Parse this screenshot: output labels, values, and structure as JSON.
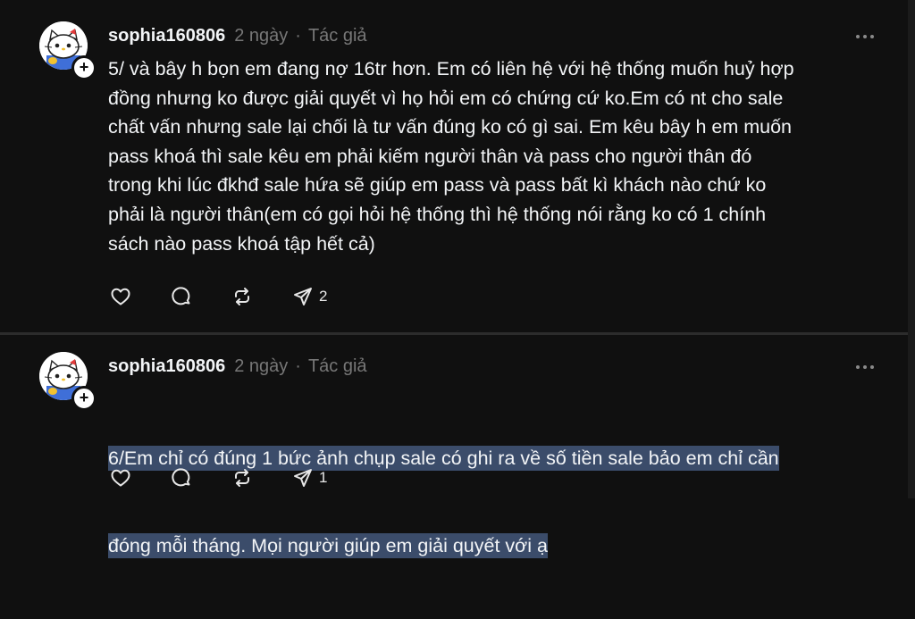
{
  "posts": [
    {
      "username": "sophia160806",
      "time": "2 ngày",
      "separator": "·",
      "role": "Tác giả",
      "follow_symbol": "+",
      "text": "5/ và bây h bọn em đang nợ 16tr hơn. Em có liên hệ với hệ thống muốn huỷ hợp\nđồng nhưng ko được giải quyết vì họ hỏi em có chứng cứ ko.Em có nt cho sale\nchất vấn nhưng sale lại chối là tư vấn đúng ko có gì sai. Em kêu bây h em muốn\npass khoá thì sale kêu em phải kiếm người thân và pass cho người thân đó\ntrong khi lúc đkhđ sale hứa sẽ giúp em pass và pass bất kì khách nào chứ ko\nphải là người thân(em có gọi hỏi hệ thống thì hệ thống nói rằng ko có 1 chính\nsách nào pass khoá tập hết cả)",
      "share_count": "2"
    },
    {
      "username": "sophia160806",
      "time": "2 ngày",
      "separator": "·",
      "role": "Tác giả",
      "follow_symbol": "+",
      "text_line1": "6/Em chỉ có đúng 1 bức ảnh chụp sale có ghi ra về số tiền sale bảo em chỉ cần",
      "text_line2": "đóng mỗi tháng. Mọi người giúp em giải quyết với ạ",
      "share_count": "1"
    }
  ],
  "icons": {
    "like": "heart-icon",
    "reply": "comment-bubble-icon",
    "repost": "repost-icon",
    "share": "send-icon",
    "more": "more-dots-icon",
    "follow": "plus-icon"
  },
  "colors": {
    "background": "#101010",
    "text": "#f3f5f7",
    "muted": "#777777",
    "selection": "#3b4c6a"
  }
}
